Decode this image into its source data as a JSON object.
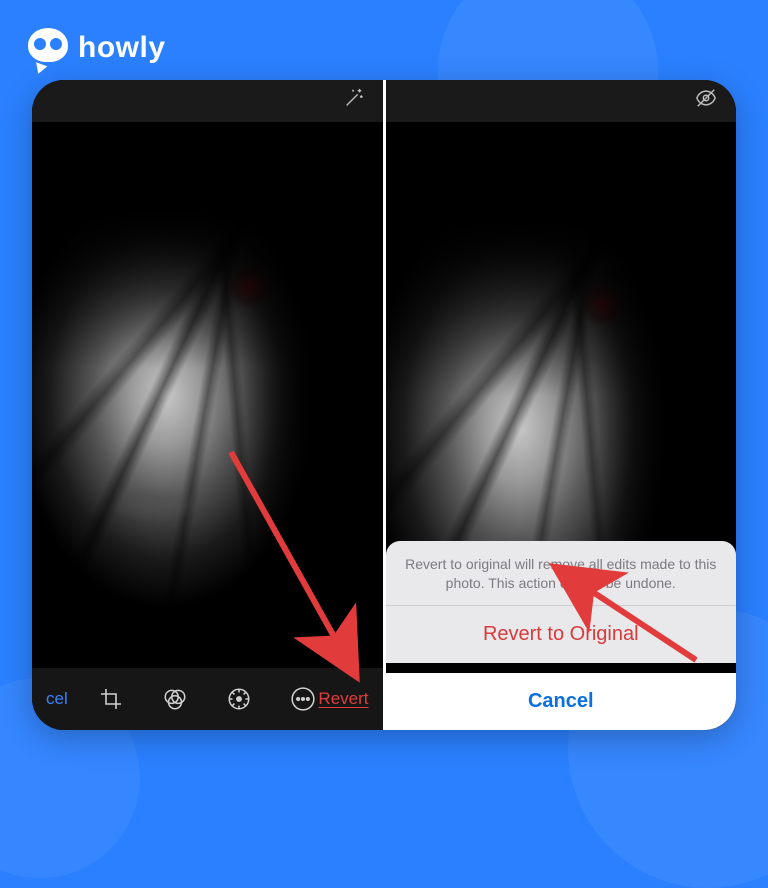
{
  "brand": {
    "name": "howly"
  },
  "left_pane": {
    "topbar_icon": "magic-wand-icon",
    "toolbar": {
      "cancel_label": "cel",
      "revert_label": "Revert",
      "tools": [
        "crop-icon",
        "filters-icon",
        "adjust-icon",
        "more-icon"
      ]
    }
  },
  "right_pane": {
    "topbar_icon": "eye-slash-icon",
    "sheet": {
      "message": "Revert to original will remove all edits made to this photo. This action cannot be undone.",
      "revert_label": "Revert to Original",
      "cancel_label": "Cancel"
    }
  },
  "annotations": {
    "arrow_color": "#e23b3b"
  }
}
